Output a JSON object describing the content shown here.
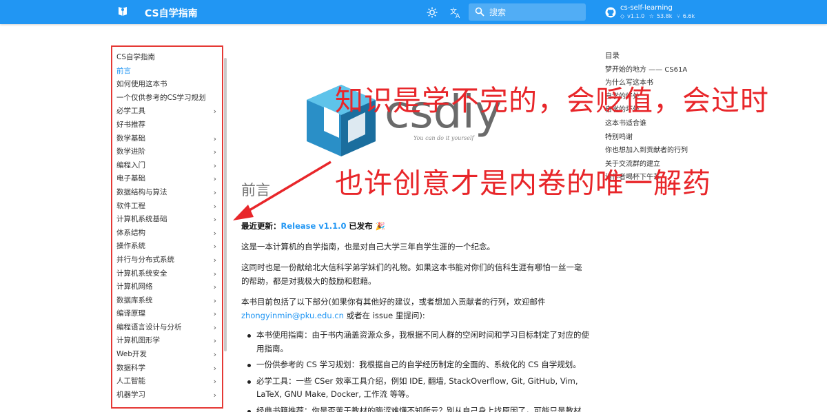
{
  "header": {
    "site_title": "CS自学指南",
    "search_placeholder": "搜索",
    "repo": {
      "name": "cs-self-learning",
      "version": "v1.1.0",
      "stars": "53.8k",
      "forks": "6.6k"
    },
    "icons": [
      "book-logo-icon",
      "brightness-icon",
      "translate-icon",
      "search-icon",
      "github-icon",
      "tag-icon",
      "star-icon",
      "fork-icon"
    ]
  },
  "sidebar": {
    "items": [
      {
        "label": "CS自学指南",
        "chevron": false,
        "active": false
      },
      {
        "label": "前言",
        "chevron": false,
        "active": true
      },
      {
        "label": "如何使用这本书",
        "chevron": false,
        "active": false
      },
      {
        "label": "一个仅供参考的CS学习规划",
        "chevron": false,
        "active": false
      },
      {
        "label": "必学工具",
        "chevron": true,
        "active": false
      },
      {
        "label": "好书推荐",
        "chevron": false,
        "active": false
      },
      {
        "label": "数学基础",
        "chevron": true,
        "active": false
      },
      {
        "label": "数学进阶",
        "chevron": true,
        "active": false
      },
      {
        "label": "编程入门",
        "chevron": true,
        "active": false
      },
      {
        "label": "电子基础",
        "chevron": true,
        "active": false
      },
      {
        "label": "数据结构与算法",
        "chevron": true,
        "active": false
      },
      {
        "label": "软件工程",
        "chevron": true,
        "active": false
      },
      {
        "label": "计算机系统基础",
        "chevron": true,
        "active": false
      },
      {
        "label": "体系结构",
        "chevron": true,
        "active": false
      },
      {
        "label": "操作系统",
        "chevron": true,
        "active": false
      },
      {
        "label": "并行与分布式系统",
        "chevron": true,
        "active": false
      },
      {
        "label": "计算机系统安全",
        "chevron": true,
        "active": false
      },
      {
        "label": "计算机网络",
        "chevron": true,
        "active": false
      },
      {
        "label": "数据库系统",
        "chevron": true,
        "active": false
      },
      {
        "label": "编译原理",
        "chevron": true,
        "active": false
      },
      {
        "label": "编程语言设计与分析",
        "chevron": true,
        "active": false
      },
      {
        "label": "计算机图形学",
        "chevron": true,
        "active": false
      },
      {
        "label": "Web开发",
        "chevron": true,
        "active": false
      },
      {
        "label": "数据科学",
        "chevron": true,
        "active": false
      },
      {
        "label": "人工智能",
        "chevron": true,
        "active": false
      },
      {
        "label": "机器学习",
        "chevron": true,
        "active": false
      }
    ]
  },
  "toc": {
    "title": "目录",
    "items": [
      "梦开始的地方 —— CS61A",
      "为什么写这本书",
      "自学的好处",
      "自学的坏处",
      "这本书适合谁",
      "特别鸣谢",
      "你也想加入到贡献者的行列",
      "关于交流群的建立",
      "请作者喝杯下午茶"
    ]
  },
  "content": {
    "page_title": "前言",
    "latest_prefix": "最近更新：",
    "latest_link": "Release v1.1.0",
    "latest_suffix": "已发布 🎉",
    "p1": "这是一本计算机的自学指南，也是对自己大学三年自学生涯的一个纪念。",
    "p2": "这同时也是一份献给北大信科学弟学妹们的礼物。如果这本书能对你们的信科生涯有哪怕一丝一毫的帮助，都是对我极大的鼓励和慰藉。",
    "p3_a": "本书目前包括了以下部分(如果你有其他好的建议，或者想加入贡献者的行列，欢迎邮件",
    "email": "zhongyinmin@pku.edu.cn",
    "p3_b": "或者在 issue 里提问):",
    "bullets": [
      "本书使用指南：由于书内涵盖资源众多，我根据不同人群的空闲时间和学习目标制定了对应的使用指南。",
      "一份供参考的 CS 学习规划：我根据自己的自学经历制定的全面的、系统化的 CS 自学规划。",
      "必学工具：一些 CSer 效率工具介绍，例如 IDE, 翻墙, StackOverflow, Git, GitHub, Vim, LaTeX, GNU Make, Docker, 工作流 等等。",
      "经典书籍推荐：你是否苦于教材的晦涩难懂不知所云？别从自己身上找原因了，可能只是教材"
    ]
  },
  "overlay": {
    "line1": "知识是学不完的，会贬值，会过时",
    "line2": "也许创意才是内卷的唯一解药",
    "watermark": "csdiy",
    "watermark_tagline": "You can do it yourself",
    "accent": "#e8262a"
  },
  "colors": {
    "primary": "#2196f3",
    "highlight_border": "#e53935"
  }
}
